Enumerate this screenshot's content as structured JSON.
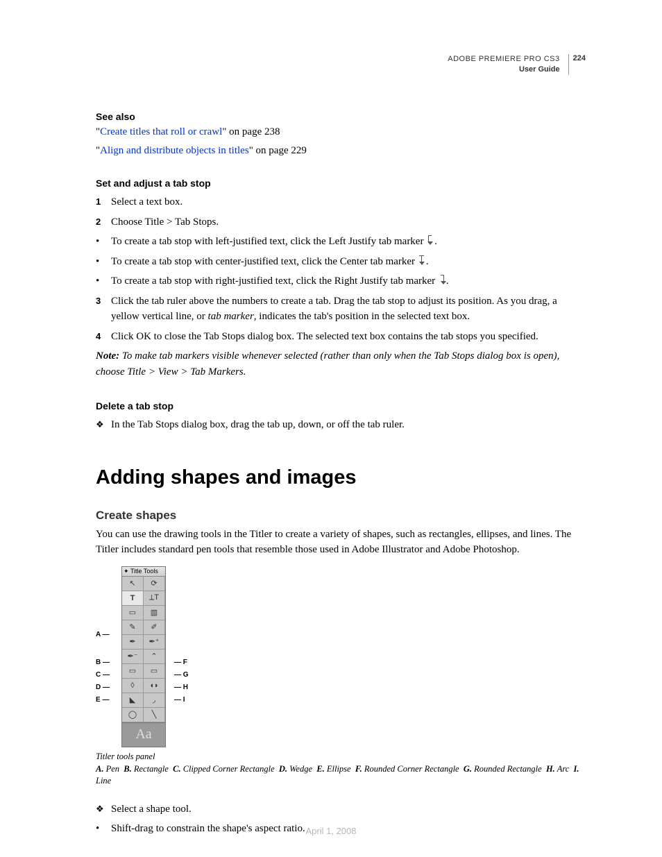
{
  "header": {
    "product": "ADOBE PREMIERE PRO CS3",
    "guide": "User Guide",
    "page": "224"
  },
  "see_also": {
    "title": "See also",
    "links": [
      {
        "text": "Create titles that roll or crawl",
        "suffix": "\" on page 238"
      },
      {
        "text": "Align and distribute objects in titles",
        "suffix": "\" on page 229"
      }
    ],
    "open_quote": "\""
  },
  "set_adjust": {
    "title": "Set and adjust a tab stop",
    "steps": {
      "s1": "Select a text box.",
      "s2": "Choose Title > Tab Stops.",
      "b1": "To create a tab stop with left-justified text, click the Left Justify tab marker ",
      "b2": "To create a tab stop with center-justified text, click the Center tab marker ",
      "b3": "To create a tab stop with right-justified text, click the Right Justify tab marker ",
      "dot": ".",
      "s3a": "Click the tab ruler above the numbers to create a tab. Drag the tab stop to adjust its position. As you drag, a yellow vertical line, or ",
      "s3i": "tab marker",
      "s3b": ", indicates the tab's position in the selected text box.",
      "s4": "Click OK to close the Tab Stops dialog box. The selected text box contains the tab stops you specified."
    },
    "note_label": "Note:",
    "note": " To make tab markers visible whenever selected (rather than only when the Tab Stops dialog box is open), choose Title > View > Tab Markers."
  },
  "delete": {
    "title": "Delete a tab stop",
    "text": "In the Tab Stops dialog box, drag the tab up, down, or off the tab ruler."
  },
  "h1": "Adding shapes and images",
  "create_shapes": {
    "title": "Create shapes",
    "body": "You can use the drawing tools in the Titler to create a variety of shapes, such as rectangles, ellipses, and lines. The Titler includes standard pen tools that resemble those used in Adobe Illustrator and Adobe Photoshop."
  },
  "panel": {
    "title": "Title Tools",
    "aa": "Aa",
    "labels": {
      "A": "A",
      "B": "B",
      "C": "C",
      "D": "D",
      "E": "E",
      "F": "F",
      "G": "G",
      "H": "H",
      "I": "I"
    }
  },
  "caption": "Titler tools panel",
  "legend": {
    "A": "Pen",
    "B": "Rectangle",
    "C": "Clipped Corner Rectangle",
    "D": "Wedge",
    "E": "Ellipse",
    "F": "Rounded Corner Rectangle",
    "G": "Rounded Rectangle",
    "H": "Arc",
    "I": "Line",
    "lA": "A.",
    "lB": "B.",
    "lC": "C.",
    "lD": "D.",
    "lE": "E.",
    "lF": "F.",
    "lG": "G.",
    "lH": "H.",
    "lI": "I."
  },
  "tail": {
    "select": "Select a shape tool.",
    "shift": "Shift-drag to constrain the shape's aspect ratio."
  },
  "footer_date": "April 1, 2008"
}
